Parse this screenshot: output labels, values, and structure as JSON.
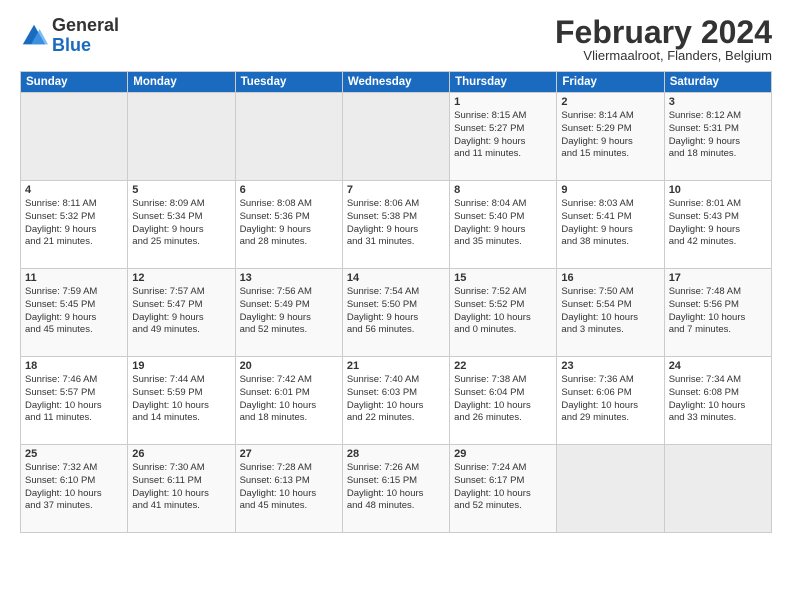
{
  "header": {
    "logo_general": "General",
    "logo_blue": "Blue",
    "month_title": "February 2024",
    "location": "Vliermaalroot, Flanders, Belgium"
  },
  "days_of_week": [
    "Sunday",
    "Monday",
    "Tuesday",
    "Wednesday",
    "Thursday",
    "Friday",
    "Saturday"
  ],
  "weeks": [
    [
      {
        "day": "",
        "info": "",
        "empty": true
      },
      {
        "day": "",
        "info": "",
        "empty": true
      },
      {
        "day": "",
        "info": "",
        "empty": true
      },
      {
        "day": "",
        "info": "",
        "empty": true
      },
      {
        "day": "1",
        "info": "Sunrise: 8:15 AM\nSunset: 5:27 PM\nDaylight: 9 hours\nand 11 minutes.",
        "empty": false
      },
      {
        "day": "2",
        "info": "Sunrise: 8:14 AM\nSunset: 5:29 PM\nDaylight: 9 hours\nand 15 minutes.",
        "empty": false
      },
      {
        "day": "3",
        "info": "Sunrise: 8:12 AM\nSunset: 5:31 PM\nDaylight: 9 hours\nand 18 minutes.",
        "empty": false
      }
    ],
    [
      {
        "day": "4",
        "info": "Sunrise: 8:11 AM\nSunset: 5:32 PM\nDaylight: 9 hours\nand 21 minutes.",
        "empty": false
      },
      {
        "day": "5",
        "info": "Sunrise: 8:09 AM\nSunset: 5:34 PM\nDaylight: 9 hours\nand 25 minutes.",
        "empty": false
      },
      {
        "day": "6",
        "info": "Sunrise: 8:08 AM\nSunset: 5:36 PM\nDaylight: 9 hours\nand 28 minutes.",
        "empty": false
      },
      {
        "day": "7",
        "info": "Sunrise: 8:06 AM\nSunset: 5:38 PM\nDaylight: 9 hours\nand 31 minutes.",
        "empty": false
      },
      {
        "day": "8",
        "info": "Sunrise: 8:04 AM\nSunset: 5:40 PM\nDaylight: 9 hours\nand 35 minutes.",
        "empty": false
      },
      {
        "day": "9",
        "info": "Sunrise: 8:03 AM\nSunset: 5:41 PM\nDaylight: 9 hours\nand 38 minutes.",
        "empty": false
      },
      {
        "day": "10",
        "info": "Sunrise: 8:01 AM\nSunset: 5:43 PM\nDaylight: 9 hours\nand 42 minutes.",
        "empty": false
      }
    ],
    [
      {
        "day": "11",
        "info": "Sunrise: 7:59 AM\nSunset: 5:45 PM\nDaylight: 9 hours\nand 45 minutes.",
        "empty": false
      },
      {
        "day": "12",
        "info": "Sunrise: 7:57 AM\nSunset: 5:47 PM\nDaylight: 9 hours\nand 49 minutes.",
        "empty": false
      },
      {
        "day": "13",
        "info": "Sunrise: 7:56 AM\nSunset: 5:49 PM\nDaylight: 9 hours\nand 52 minutes.",
        "empty": false
      },
      {
        "day": "14",
        "info": "Sunrise: 7:54 AM\nSunset: 5:50 PM\nDaylight: 9 hours\nand 56 minutes.",
        "empty": false
      },
      {
        "day": "15",
        "info": "Sunrise: 7:52 AM\nSunset: 5:52 PM\nDaylight: 10 hours\nand 0 minutes.",
        "empty": false
      },
      {
        "day": "16",
        "info": "Sunrise: 7:50 AM\nSunset: 5:54 PM\nDaylight: 10 hours\nand 3 minutes.",
        "empty": false
      },
      {
        "day": "17",
        "info": "Sunrise: 7:48 AM\nSunset: 5:56 PM\nDaylight: 10 hours\nand 7 minutes.",
        "empty": false
      }
    ],
    [
      {
        "day": "18",
        "info": "Sunrise: 7:46 AM\nSunset: 5:57 PM\nDaylight: 10 hours\nand 11 minutes.",
        "empty": false
      },
      {
        "day": "19",
        "info": "Sunrise: 7:44 AM\nSunset: 5:59 PM\nDaylight: 10 hours\nand 14 minutes.",
        "empty": false
      },
      {
        "day": "20",
        "info": "Sunrise: 7:42 AM\nSunset: 6:01 PM\nDaylight: 10 hours\nand 18 minutes.",
        "empty": false
      },
      {
        "day": "21",
        "info": "Sunrise: 7:40 AM\nSunset: 6:03 PM\nDaylight: 10 hours\nand 22 minutes.",
        "empty": false
      },
      {
        "day": "22",
        "info": "Sunrise: 7:38 AM\nSunset: 6:04 PM\nDaylight: 10 hours\nand 26 minutes.",
        "empty": false
      },
      {
        "day": "23",
        "info": "Sunrise: 7:36 AM\nSunset: 6:06 PM\nDaylight: 10 hours\nand 29 minutes.",
        "empty": false
      },
      {
        "day": "24",
        "info": "Sunrise: 7:34 AM\nSunset: 6:08 PM\nDaylight: 10 hours\nand 33 minutes.",
        "empty": false
      }
    ],
    [
      {
        "day": "25",
        "info": "Sunrise: 7:32 AM\nSunset: 6:10 PM\nDaylight: 10 hours\nand 37 minutes.",
        "empty": false
      },
      {
        "day": "26",
        "info": "Sunrise: 7:30 AM\nSunset: 6:11 PM\nDaylight: 10 hours\nand 41 minutes.",
        "empty": false
      },
      {
        "day": "27",
        "info": "Sunrise: 7:28 AM\nSunset: 6:13 PM\nDaylight: 10 hours\nand 45 minutes.",
        "empty": false
      },
      {
        "day": "28",
        "info": "Sunrise: 7:26 AM\nSunset: 6:15 PM\nDaylight: 10 hours\nand 48 minutes.",
        "empty": false
      },
      {
        "day": "29",
        "info": "Sunrise: 7:24 AM\nSunset: 6:17 PM\nDaylight: 10 hours\nand 52 minutes.",
        "empty": false
      },
      {
        "day": "",
        "info": "",
        "empty": true
      },
      {
        "day": "",
        "info": "",
        "empty": true
      }
    ]
  ]
}
